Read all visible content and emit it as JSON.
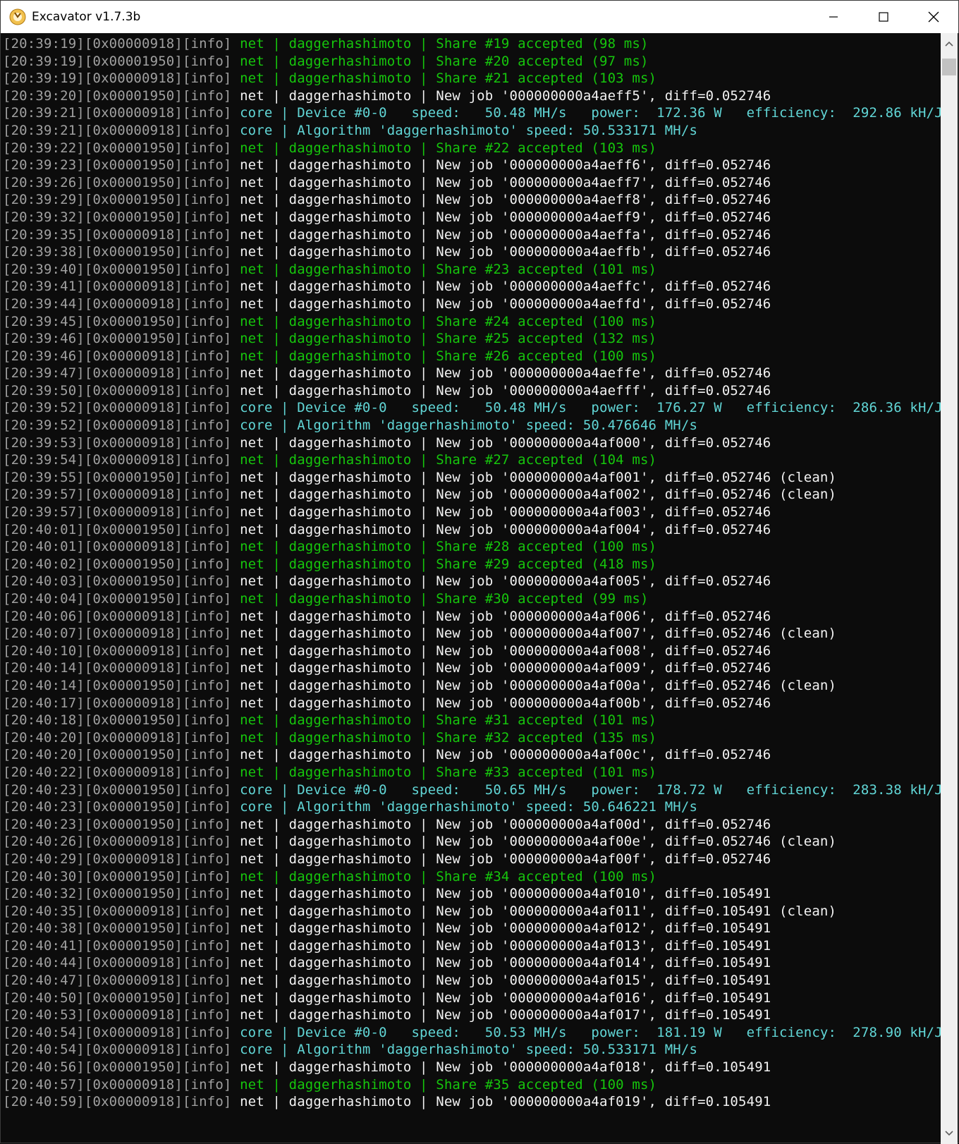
{
  "window": {
    "title": "Excavator v1.7.3b"
  },
  "lines": [
    {
      "ts": "[20:39:19][0x00000918][info]",
      "kind": "share",
      "text": " net | daggerhashimoto | Share #19 accepted (98 ms)"
    },
    {
      "ts": "[20:39:19][0x00001950][info]",
      "kind": "share",
      "text": " net | daggerhashimoto | Share #20 accepted (97 ms)"
    },
    {
      "ts": "[20:39:19][0x00000918][info]",
      "kind": "share",
      "text": " net | daggerhashimoto | Share #21 accepted (103 ms)"
    },
    {
      "ts": "[20:39:20][0x00001950][info]",
      "kind": "job",
      "text": " net | daggerhashimoto | New job '000000000a4aeff5', diff=0.052746"
    },
    {
      "ts": "[20:39:21][0x00000918][info]",
      "kind": "core",
      "text": " core | Device #0-0   speed:   50.48 MH/s   power:  172.36 W   efficiency:  292.86 kH/J"
    },
    {
      "ts": "[20:39:21][0x00000918][info]",
      "kind": "core",
      "text": " core | Algorithm 'daggerhashimoto' speed: 50.533171 MH/s"
    },
    {
      "ts": "[20:39:22][0x00001950][info]",
      "kind": "share",
      "text": " net | daggerhashimoto | Share #22 accepted (103 ms)"
    },
    {
      "ts": "[20:39:23][0x00001950][info]",
      "kind": "job",
      "text": " net | daggerhashimoto | New job '000000000a4aeff6', diff=0.052746"
    },
    {
      "ts": "[20:39:26][0x00001950][info]",
      "kind": "job",
      "text": " net | daggerhashimoto | New job '000000000a4aeff7', diff=0.052746"
    },
    {
      "ts": "[20:39:29][0x00001950][info]",
      "kind": "job",
      "text": " net | daggerhashimoto | New job '000000000a4aeff8', diff=0.052746"
    },
    {
      "ts": "[20:39:32][0x00001950][info]",
      "kind": "job",
      "text": " net | daggerhashimoto | New job '000000000a4aeff9', diff=0.052746"
    },
    {
      "ts": "[20:39:35][0x00000918][info]",
      "kind": "job",
      "text": " net | daggerhashimoto | New job '000000000a4aeffa', diff=0.052746"
    },
    {
      "ts": "[20:39:38][0x00001950][info]",
      "kind": "job",
      "text": " net | daggerhashimoto | New job '000000000a4aeffb', diff=0.052746"
    },
    {
      "ts": "[20:39:40][0x00001950][info]",
      "kind": "share",
      "text": " net | daggerhashimoto | Share #23 accepted (101 ms)"
    },
    {
      "ts": "[20:39:41][0x00000918][info]",
      "kind": "job",
      "text": " net | daggerhashimoto | New job '000000000a4aeffc', diff=0.052746"
    },
    {
      "ts": "[20:39:44][0x00000918][info]",
      "kind": "job",
      "text": " net | daggerhashimoto | New job '000000000a4aeffd', diff=0.052746"
    },
    {
      "ts": "[20:39:45][0x00001950][info]",
      "kind": "share",
      "text": " net | daggerhashimoto | Share #24 accepted (100 ms)"
    },
    {
      "ts": "[20:39:46][0x00001950][info]",
      "kind": "share",
      "text": " net | daggerhashimoto | Share #25 accepted (132 ms)"
    },
    {
      "ts": "[20:39:46][0x00000918][info]",
      "kind": "share",
      "text": " net | daggerhashimoto | Share #26 accepted (100 ms)"
    },
    {
      "ts": "[20:39:47][0x00000918][info]",
      "kind": "job",
      "text": " net | daggerhashimoto | New job '000000000a4aeffe', diff=0.052746"
    },
    {
      "ts": "[20:39:50][0x00000918][info]",
      "kind": "job",
      "text": " net | daggerhashimoto | New job '000000000a4aefff', diff=0.052746"
    },
    {
      "ts": "[20:39:52][0x00000918][info]",
      "kind": "core",
      "text": " core | Device #0-0   speed:   50.48 MH/s   power:  176.27 W   efficiency:  286.36 kH/J"
    },
    {
      "ts": "[20:39:52][0x00000918][info]",
      "kind": "core",
      "text": " core | Algorithm 'daggerhashimoto' speed: 50.476646 MH/s"
    },
    {
      "ts": "[20:39:53][0x00000918][info]",
      "kind": "job",
      "text": " net | daggerhashimoto | New job '000000000a4af000', diff=0.052746"
    },
    {
      "ts": "[20:39:54][0x00000918][info]",
      "kind": "share",
      "text": " net | daggerhashimoto | Share #27 accepted (104 ms)"
    },
    {
      "ts": "[20:39:55][0x00001950][info]",
      "kind": "job",
      "text": " net | daggerhashimoto | New job '000000000a4af001', diff=0.052746 (clean)"
    },
    {
      "ts": "[20:39:57][0x00000918][info]",
      "kind": "job",
      "text": " net | daggerhashimoto | New job '000000000a4af002', diff=0.052746 (clean)"
    },
    {
      "ts": "[20:39:57][0x00000918][info]",
      "kind": "job",
      "text": " net | daggerhashimoto | New job '000000000a4af003', diff=0.052746"
    },
    {
      "ts": "[20:40:01][0x00001950][info]",
      "kind": "job",
      "text": " net | daggerhashimoto | New job '000000000a4af004', diff=0.052746"
    },
    {
      "ts": "[20:40:01][0x00000918][info]",
      "kind": "share",
      "text": " net | daggerhashimoto | Share #28 accepted (100 ms)"
    },
    {
      "ts": "[20:40:02][0x00001950][info]",
      "kind": "share",
      "text": " net | daggerhashimoto | Share #29 accepted (418 ms)"
    },
    {
      "ts": "[20:40:03][0x00001950][info]",
      "kind": "job",
      "text": " net | daggerhashimoto | New job '000000000a4af005', diff=0.052746"
    },
    {
      "ts": "[20:40:04][0x00001950][info]",
      "kind": "share",
      "text": " net | daggerhashimoto | Share #30 accepted (99 ms)"
    },
    {
      "ts": "[20:40:06][0x00000918][info]",
      "kind": "job",
      "text": " net | daggerhashimoto | New job '000000000a4af006', diff=0.052746"
    },
    {
      "ts": "[20:40:07][0x00000918][info]",
      "kind": "job",
      "text": " net | daggerhashimoto | New job '000000000a4af007', diff=0.052746 (clean)"
    },
    {
      "ts": "[20:40:10][0x00000918][info]",
      "kind": "job",
      "text": " net | daggerhashimoto | New job '000000000a4af008', diff=0.052746"
    },
    {
      "ts": "[20:40:14][0x00000918][info]",
      "kind": "job",
      "text": " net | daggerhashimoto | New job '000000000a4af009', diff=0.052746"
    },
    {
      "ts": "[20:40:14][0x00001950][info]",
      "kind": "job",
      "text": " net | daggerhashimoto | New job '000000000a4af00a', diff=0.052746 (clean)"
    },
    {
      "ts": "[20:40:17][0x00000918][info]",
      "kind": "job",
      "text": " net | daggerhashimoto | New job '000000000a4af00b', diff=0.052746"
    },
    {
      "ts": "[20:40:18][0x00001950][info]",
      "kind": "share",
      "text": " net | daggerhashimoto | Share #31 accepted (101 ms)"
    },
    {
      "ts": "[20:40:20][0x00000918][info]",
      "kind": "share",
      "text": " net | daggerhashimoto | Share #32 accepted (135 ms)"
    },
    {
      "ts": "[20:40:20][0x00001950][info]",
      "kind": "job",
      "text": " net | daggerhashimoto | New job '000000000a4af00c', diff=0.052746"
    },
    {
      "ts": "[20:40:22][0x00000918][info]",
      "kind": "share",
      "text": " net | daggerhashimoto | Share #33 accepted (101 ms)"
    },
    {
      "ts": "[20:40:23][0x00001950][info]",
      "kind": "core",
      "text": " core | Device #0-0   speed:   50.65 MH/s   power:  178.72 W   efficiency:  283.38 kH/J"
    },
    {
      "ts": "[20:40:23][0x00001950][info]",
      "kind": "core",
      "text": " core | Algorithm 'daggerhashimoto' speed: 50.646221 MH/s"
    },
    {
      "ts": "[20:40:23][0x00001950][info]",
      "kind": "job",
      "text": " net | daggerhashimoto | New job '000000000a4af00d', diff=0.052746"
    },
    {
      "ts": "[20:40:26][0x00000918][info]",
      "kind": "job",
      "text": " net | daggerhashimoto | New job '000000000a4af00e', diff=0.052746 (clean)"
    },
    {
      "ts": "[20:40:29][0x00000918][info]",
      "kind": "job",
      "text": " net | daggerhashimoto | New job '000000000a4af00f', diff=0.052746"
    },
    {
      "ts": "[20:40:30][0x00001950][info]",
      "kind": "share",
      "text": " net | daggerhashimoto | Share #34 accepted (100 ms)"
    },
    {
      "ts": "[20:40:32][0x00001950][info]",
      "kind": "job",
      "text": " net | daggerhashimoto | New job '000000000a4af010', diff=0.105491"
    },
    {
      "ts": "[20:40:35][0x00000918][info]",
      "kind": "job",
      "text": " net | daggerhashimoto | New job '000000000a4af011', diff=0.105491 (clean)"
    },
    {
      "ts": "[20:40:38][0x00001950][info]",
      "kind": "job",
      "text": " net | daggerhashimoto | New job '000000000a4af012', diff=0.105491"
    },
    {
      "ts": "[20:40:41][0x00001950][info]",
      "kind": "job",
      "text": " net | daggerhashimoto | New job '000000000a4af013', diff=0.105491"
    },
    {
      "ts": "[20:40:44][0x00000918][info]",
      "kind": "job",
      "text": " net | daggerhashimoto | New job '000000000a4af014', diff=0.105491"
    },
    {
      "ts": "[20:40:47][0x00000918][info]",
      "kind": "job",
      "text": " net | daggerhashimoto | New job '000000000a4af015', diff=0.105491"
    },
    {
      "ts": "[20:40:50][0x00001950][info]",
      "kind": "job",
      "text": " net | daggerhashimoto | New job '000000000a4af016', diff=0.105491"
    },
    {
      "ts": "[20:40:53][0x00000918][info]",
      "kind": "job",
      "text": " net | daggerhashimoto | New job '000000000a4af017', diff=0.105491"
    },
    {
      "ts": "[20:40:54][0x00000918][info]",
      "kind": "core",
      "text": " core | Device #0-0   speed:   50.53 MH/s   power:  181.19 W   efficiency:  278.90 kH/J"
    },
    {
      "ts": "[20:40:54][0x00000918][info]",
      "kind": "core",
      "text": " core | Algorithm 'daggerhashimoto' speed: 50.533171 MH/s"
    },
    {
      "ts": "[20:40:56][0x00001950][info]",
      "kind": "job",
      "text": " net | daggerhashimoto | New job '000000000a4af018', diff=0.105491"
    },
    {
      "ts": "[20:40:57][0x00000918][info]",
      "kind": "share",
      "text": " net | daggerhashimoto | Share #35 accepted (100 ms)"
    },
    {
      "ts": "[20:40:59][0x00000918][info]",
      "kind": "job",
      "text": " net | daggerhashimoto | New job '000000000a4af019', diff=0.105491"
    }
  ],
  "colors": {
    "meta": "#a0a0a0",
    "job": "#f2f2f2",
    "share": "#16c60c",
    "core": "#61d6d6",
    "background": "#0c0c0c"
  },
  "icons": {
    "app": "excavator-app-icon",
    "minimize": "minimize-icon",
    "maximize": "maximize-icon",
    "close": "close-icon"
  }
}
